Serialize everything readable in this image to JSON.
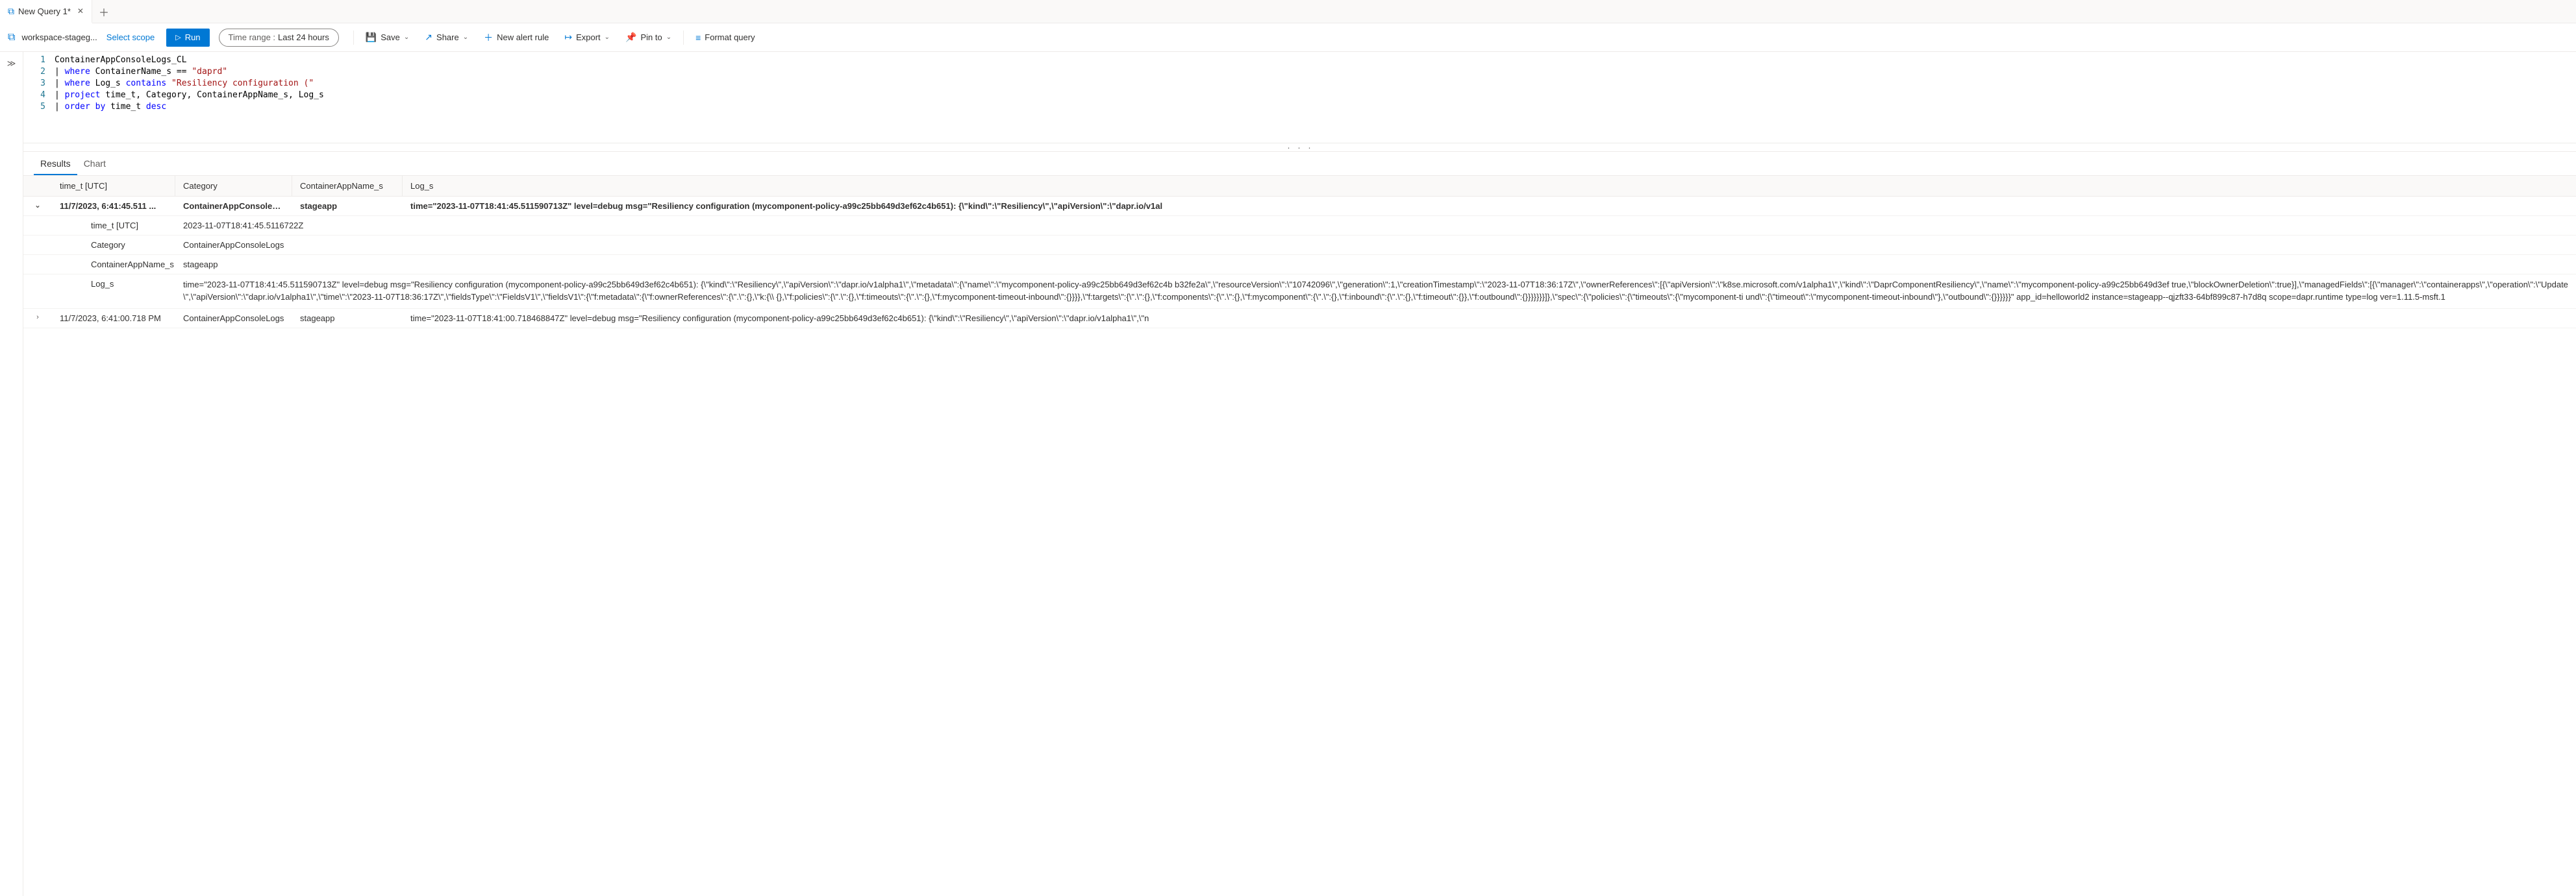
{
  "tabs": {
    "active": {
      "title": "New Query 1*"
    }
  },
  "toolbar": {
    "workspace": "workspace-stageg...",
    "select_scope": "Select scope",
    "run": "Run",
    "time_range_label": "Time range :",
    "time_range_value": "Last 24 hours",
    "save": "Save",
    "share": "Share",
    "new_alert": "New alert rule",
    "export": "Export",
    "pin": "Pin to",
    "format": "Format query"
  },
  "editor": {
    "lines": [
      {
        "n": "1",
        "raw": "ContainerAppConsoleLogs_CL"
      },
      {
        "n": "2",
        "raw": "| where ContainerName_s == \"daprd\""
      },
      {
        "n": "3",
        "raw": "| where Log_s contains \"Resiliency configuration (\""
      },
      {
        "n": "4",
        "raw": "| project time_t, Category, ContainerAppName_s, Log_s"
      },
      {
        "n": "5",
        "raw": "| order by time_t desc"
      }
    ]
  },
  "result_tabs": {
    "results": "Results",
    "chart": "Chart"
  },
  "grid": {
    "headers": {
      "time": "time_t [UTC]",
      "category": "Category",
      "app": "ContainerAppName_s",
      "log": "Log_s"
    },
    "rows": [
      {
        "expanded": true,
        "time": "11/7/2023, 6:41:45.511 ...",
        "category": "ContainerAppConsoleLogs",
        "app": "stageapp",
        "log_preview": "time=\"2023-11-07T18:41:45.511590713Z\" level=debug msg=\"Resiliency configuration (mycomponent-policy-a99c25bb649d3ef62c4b651): {\\\"kind\\\":\\\"Resiliency\\\",\\\"apiVersion\\\":\\\"dapr.io/v1al",
        "details": {
          "time_t_label": "time_t [UTC]",
          "time_t_value": "2023-11-07T18:41:45.5116722Z",
          "category_label": "Category",
          "category_value": "ContainerAppConsoleLogs",
          "app_label": "ContainerAppName_s",
          "app_value": "stageapp",
          "log_label": "Log_s",
          "log_value": "time=\"2023-11-07T18:41:45.511590713Z\" level=debug msg=\"Resiliency configuration (mycomponent-policy-a99c25bb649d3ef62c4b651): {\\\"kind\\\":\\\"Resiliency\\\",\\\"apiVersion\\\":\\\"dapr.io/v1alpha1\\\",\\\"metadata\\\":{\\\"name\\\":\\\"mycomponent-policy-a99c25bb649d3ef62c4b b32fe2a\\\",\\\"resourceVersion\\\":\\\"10742096\\\",\\\"generation\\\":1,\\\"creationTimestamp\\\":\\\"2023-11-07T18:36:17Z\\\",\\\"ownerReferences\\\":[{\\\"apiVersion\\\":\\\"k8se.microsoft.com/v1alpha1\\\",\\\"kind\\\":\\\"DaprComponentResiliency\\\",\\\"name\\\":\\\"mycomponent-policy-a99c25bb649d3ef true,\\\"blockOwnerDeletion\\\":true}],\\\"managedFields\\\":[{\\\"manager\\\":\\\"containerapps\\\",\\\"operation\\\":\\\"Update\\\",\\\"apiVersion\\\":\\\"dapr.io/v1alpha1\\\",\\\"time\\\":\\\"2023-11-07T18:36:17Z\\\",\\\"fieldsType\\\":\\\"FieldsV1\\\",\\\"fieldsV1\\\":{\\\"f:metadata\\\":{\\\"f:ownerReferences\\\":{\\\".\\\":{},\\\"k:{\\\\ {},\\\"f:policies\\\":{\\\".\\\":{},\\\"f:timeouts\\\":{\\\".\\\":{},\\\"f:mycomponent-timeout-inbound\\\":{}}}},\\\"f:targets\\\":{\\\".\\\":{},\\\"f:components\\\":{\\\".\\\":{},\\\"f:mycomponent\\\":{\\\".\\\":{},\\\"f:inbound\\\":{\\\".\\\":{},\\\"f:timeout\\\":{}},\\\"f:outbound\\\":{}}}}}}}]},\\\"spec\\\":{\\\"policies\\\":{\\\"timeouts\\\":{\\\"mycomponent-ti und\\\":{\\\"timeout\\\":\\\"mycomponent-timeout-inbound\\\"},\\\"outbound\\\":{}}}}}}\" app_id=helloworld2 instance=stageapp--qjzft33-64bf899c87-h7d8q scope=dapr.runtime type=log ver=1.11.5-msft.1"
        }
      },
      {
        "expanded": false,
        "time": "11/7/2023, 6:41:00.718 PM",
        "category": "ContainerAppConsoleLogs",
        "app": "stageapp",
        "log_preview": "time=\"2023-11-07T18:41:00.718468847Z\" level=debug msg=\"Resiliency configuration (mycomponent-policy-a99c25bb649d3ef62c4b651): {\\\"kind\\\":\\\"Resiliency\\\",\\\"apiVersion\\\":\\\"dapr.io/v1alpha1\\\",\\\"n"
      }
    ]
  },
  "resize_dots": ". . ."
}
